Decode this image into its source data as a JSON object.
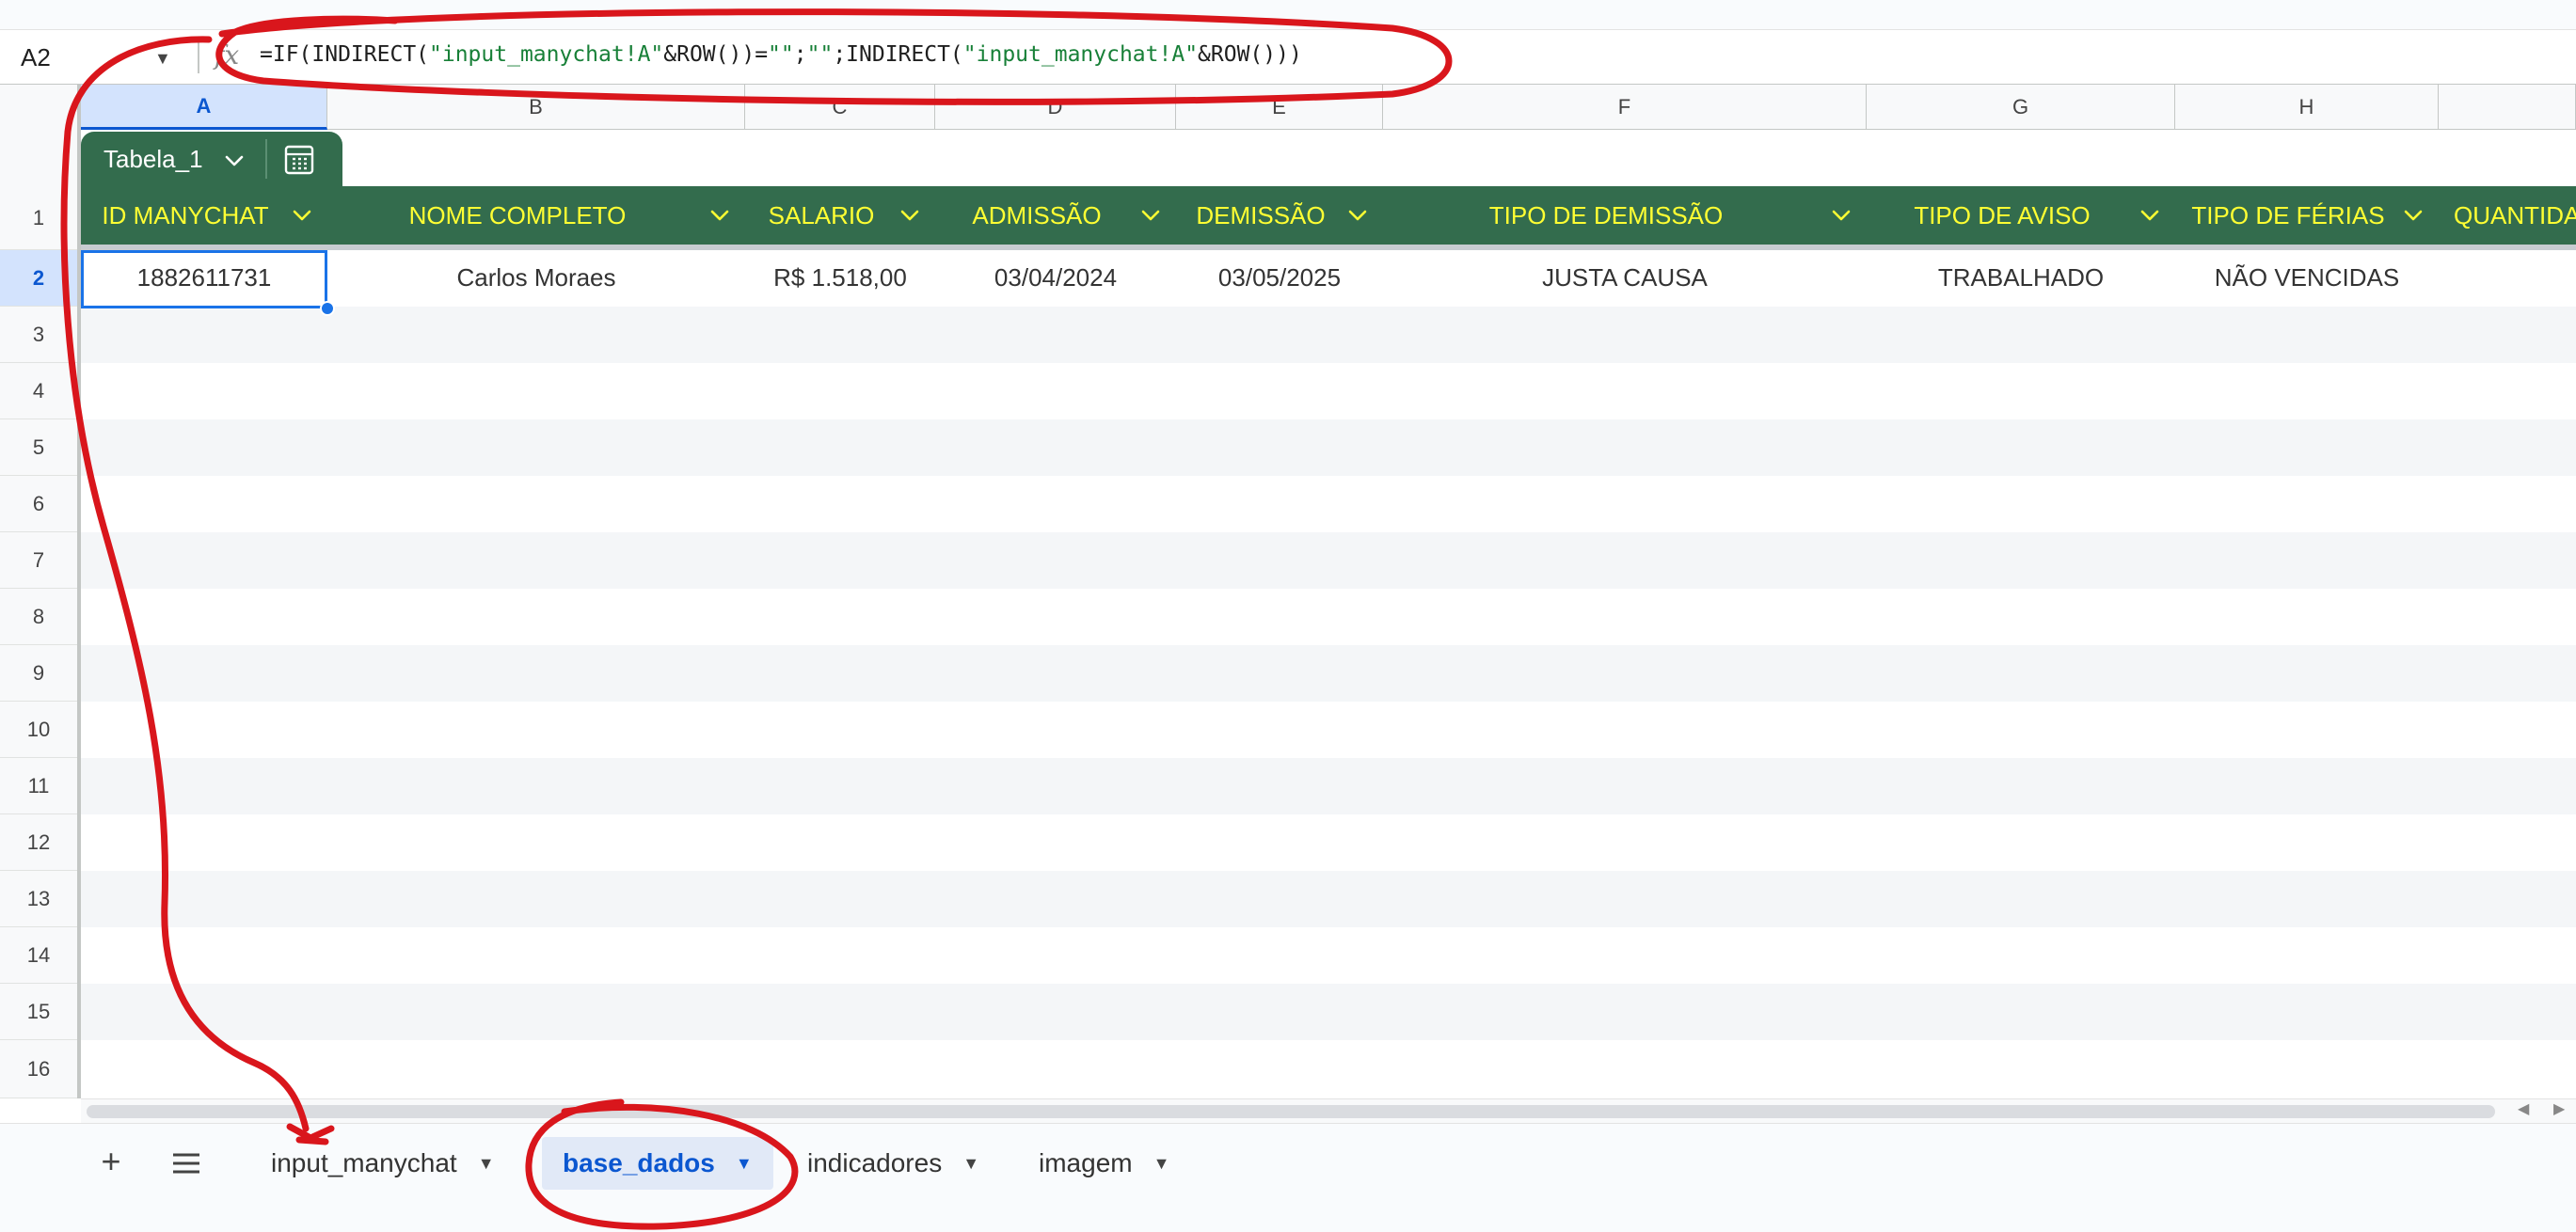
{
  "formula_bar": {
    "cell_ref": "A2",
    "fx_icon": "fx-icon",
    "formula_parts": [
      {
        "t": "=IF(INDIRECT(",
        "s": false
      },
      {
        "t": "\"input_manychat!A\"",
        "s": true
      },
      {
        "t": "&ROW())=",
        "s": false
      },
      {
        "t": "\"\"",
        "s": true
      },
      {
        "t": ";",
        "s": false
      },
      {
        "t": "\"\"",
        "s": true
      },
      {
        "t": ";INDIRECT(",
        "s": false
      },
      {
        "t": "\"input_manychat!A\"",
        "s": true
      },
      {
        "t": "&ROW()))",
        "s": false
      }
    ]
  },
  "columns": [
    "A",
    "B",
    "C",
    "D",
    "E",
    "F",
    "G",
    "H",
    ""
  ],
  "selected_column": "A",
  "rows": [
    "1",
    "2",
    "3",
    "4",
    "5",
    "6",
    "7",
    "8",
    "9",
    "10",
    "11",
    "12",
    "13",
    "14",
    "15",
    "16"
  ],
  "selected_row": "2",
  "table": {
    "name": "Tabela_1",
    "headers": [
      "ID MANYCHAT",
      "NOME COMPLETO",
      "SALARIO",
      "ADMISSÃO",
      "DEMISSÃO",
      "TIPO DE DEMISSÃO",
      "TIPO DE AVISO",
      "TIPO DE FÉRIAS",
      "QUANTIDA"
    ],
    "rows": [
      [
        "1882611731",
        "Carlos Moraes",
        "R$ 1.518,00",
        "03/04/2024",
        "03/05/2025",
        "JUSTA CAUSA",
        "TRABALHADO",
        "NÃO VENCIDAS",
        ""
      ]
    ]
  },
  "sheet_tabs": [
    {
      "label": "input_manychat",
      "active": false
    },
    {
      "label": "base_dados",
      "active": true
    },
    {
      "label": "indicadores",
      "active": false
    },
    {
      "label": "imagem",
      "active": false
    }
  ],
  "icons": {
    "add_sheet": "plus-icon",
    "all_sheets": "hamburger-menu-icon",
    "table_tool": "calculator-grid-icon"
  },
  "colors": {
    "table_header_bg": "#336c4d",
    "table_header_text": "#ffff33",
    "selection": "#1a73e8",
    "active_tab_text": "#0b57d0",
    "annotation": "#d9161c"
  }
}
